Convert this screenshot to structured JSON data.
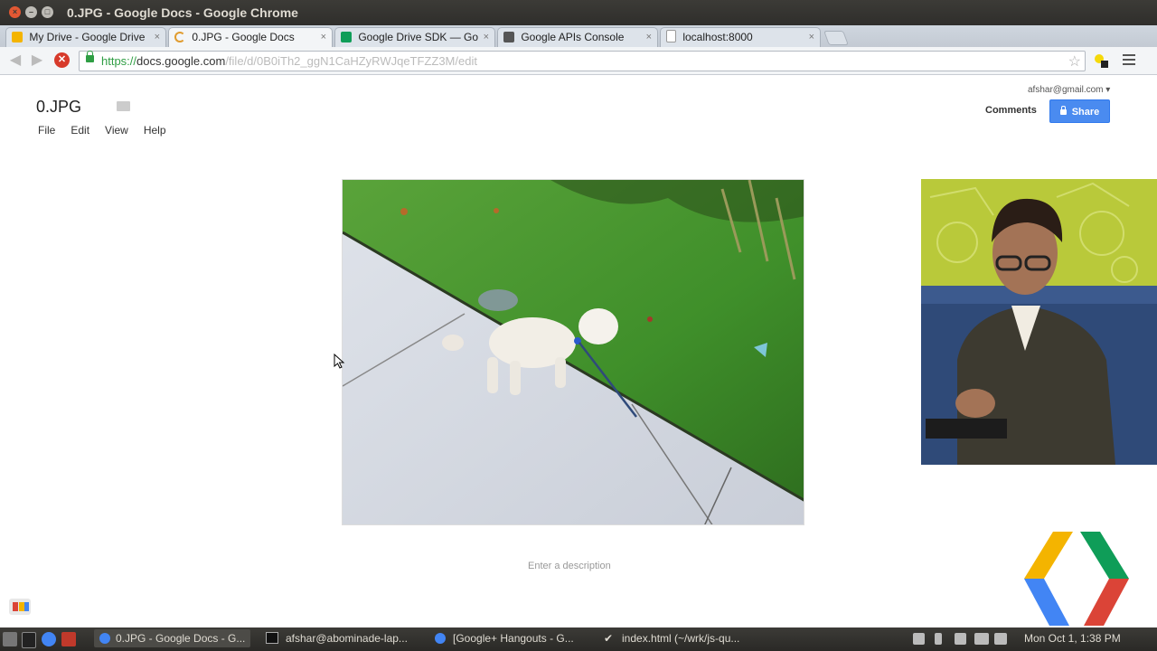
{
  "window": {
    "title": "0.JPG - Google Docs - Google Chrome"
  },
  "tabs": [
    {
      "label": "My Drive - Google Drive",
      "icon": "google-drive-icon",
      "active": false
    },
    {
      "label": "0.JPG - Google Docs",
      "icon": "loading-spinner-icon",
      "active": true
    },
    {
      "label": "Google Drive SDK — Go",
      "icon": "google-drive-icon",
      "active": false
    },
    {
      "label": "Google APIs Console",
      "icon": "api-console-icon",
      "active": false
    },
    {
      "label": "localhost:8000",
      "icon": "page-icon",
      "active": false
    }
  ],
  "omnibox": {
    "scheme": "https://",
    "host": "docs.google.com",
    "path": "/file/d/0B0iTh2_ggN1CaHZyRWJqeTFZZ3M/edit"
  },
  "doc": {
    "title": "0.JPG",
    "menu": [
      "File",
      "Edit",
      "View",
      "Help"
    ],
    "account": "afshar@gmail.com ▾",
    "comments_label": "Comments",
    "share_label": "Share",
    "description_placeholder": "Enter a description"
  },
  "taskbar": {
    "items": [
      {
        "label": "0.JPG - Google Docs - G...",
        "icon": "chrome-icon",
        "active": true
      },
      {
        "label": "afshar@abominade-lap...",
        "icon": "terminal-icon",
        "active": false
      },
      {
        "label": "[Google+ Hangouts - G...",
        "icon": "chrome-icon",
        "active": false
      },
      {
        "label": "index.html (~/wrk/js-qu...",
        "icon": "editor-icon",
        "active": false
      }
    ],
    "clock": "Mon Oct  1,  1:38 PM"
  },
  "colors": {
    "share_blue": "#4a8bf0",
    "titlebar": "#3c3b37",
    "grass_green": "#3f8f2a"
  }
}
